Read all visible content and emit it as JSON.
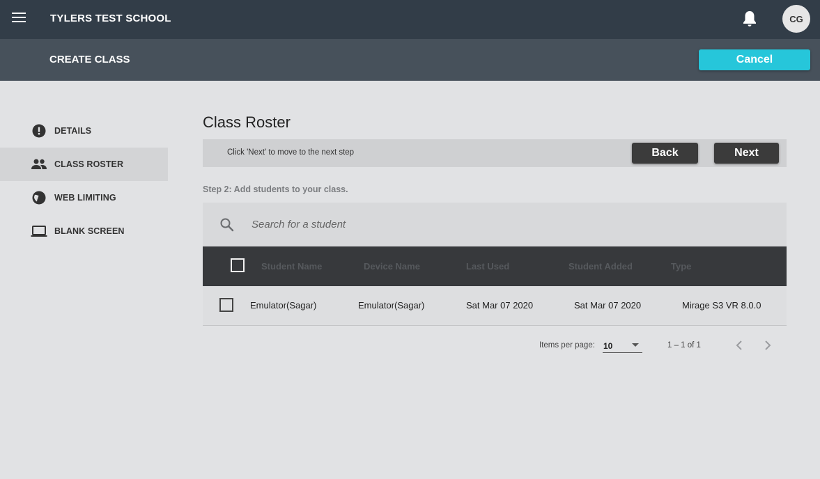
{
  "topbar": {
    "school_name": "TYLERS TEST SCHOOL",
    "avatar_initials": "CG",
    "menu_icon": "hamburger-menu-icon",
    "bell_icon": "bell-icon"
  },
  "subbar": {
    "title": "CREATE CLASS",
    "cancel_label": "Cancel"
  },
  "sidebar": {
    "items": [
      {
        "label": "DETAILS",
        "icon": "alert-circle-icon",
        "active": false
      },
      {
        "label": "CLASS ROSTER",
        "icon": "people-icon",
        "active": true
      },
      {
        "label": "WEB LIMITING",
        "icon": "globe-icon",
        "active": false
      },
      {
        "label": "BLANK SCREEN",
        "icon": "laptop-icon",
        "active": false
      }
    ]
  },
  "main": {
    "title": "Class Roster",
    "step_hint": "Click 'Next' to move to the next step",
    "back_label": "Back",
    "next_label": "Next",
    "step_label": "Step 2: Add students to your class.",
    "search_placeholder": "Search for a student"
  },
  "table": {
    "columns": [
      "Student Name",
      "Device Name",
      "Last Used",
      "Student Added",
      "Type"
    ],
    "rows": [
      {
        "student_name": "Emulator(Sagar)",
        "device_name": "Emulator(Sagar)",
        "last_used": "Sat Mar 07 2020",
        "student_added": "Sat Mar 07 2020",
        "type": "Mirage S3 VR 8.0.0"
      }
    ]
  },
  "pagination": {
    "items_per_page_label": "Items per page:",
    "items_per_page": "10",
    "range": "1 – 1 of 1"
  },
  "colors": {
    "topbar": "#323d48",
    "subbar": "#47515b",
    "accent": "#26c6da",
    "table_header": "#37393c"
  }
}
